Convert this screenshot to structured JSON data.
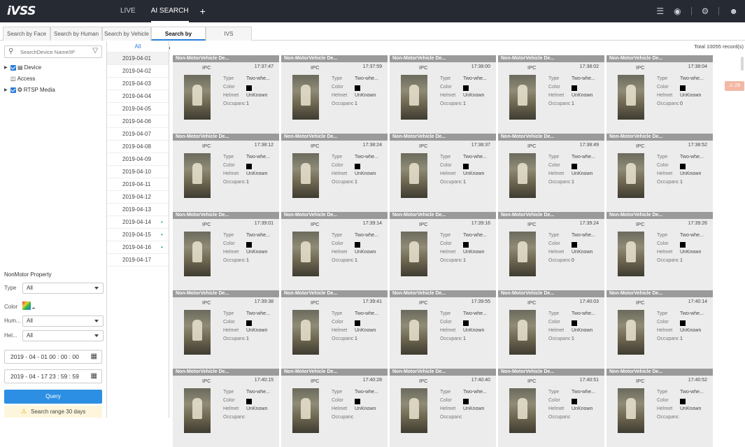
{
  "app": {
    "logo": "iVSS"
  },
  "topnav": {
    "items": [
      "LIVE",
      "AI SEARCH"
    ],
    "add": "+"
  },
  "tabs": [
    "Search by Face",
    "Search by Human",
    "Search by Vehicle",
    "Search by NonMotor",
    "IVS"
  ],
  "left": {
    "search_placeholder": "SearchDevice Name/IP",
    "tree": [
      "Device",
      "Access",
      "RTSP Media"
    ],
    "props_title": "NonMotor Property",
    "type_label": "Type",
    "type_value": "All",
    "color_label": "Color",
    "helmet_num_label": "Hum...",
    "helmet_num_value": "All",
    "helmet_label": "Hel...",
    "helmet_value": "All",
    "start_time": "2019 - 04 - 01   00 : 00 : 00",
    "end_time": "2019 - 04 - 17   23 : 59 : 59",
    "query": "Query",
    "warning": "Search range 30 days"
  },
  "dates": {
    "all": "All",
    "items": [
      "2019-04-01",
      "2019-04-02",
      "2019-04-03",
      "2019-04-04",
      "2019-04-05",
      "2019-04-06",
      "2019-04-07",
      "2019-04-08",
      "2019-04-09",
      "2019-04-10",
      "2019-04-11",
      "2019-04-12",
      "2019-04-13",
      "2019-04-14",
      "2019-04-15",
      "2019-04-16",
      "2019-04-17"
    ],
    "dotted": [
      "2019-04-14",
      "2019-04-15",
      "2019-04-16"
    ]
  },
  "results": {
    "total": "Total 10055 record(s)",
    "card_title": "Non-MotorVehicle De...",
    "source": "IPC",
    "labels": {
      "type": "Type",
      "color": "Color",
      "helmet": "Helmet",
      "occupants": "Occupanc"
    },
    "type_value": "Two-whe...",
    "helmet_value": "UnKnown",
    "cards": [
      {
        "time": "17:37:47",
        "occ": "1"
      },
      {
        "time": "17:37:59",
        "occ": "1"
      },
      {
        "time": "17:38:00",
        "occ": "1"
      },
      {
        "time": "17:38:02",
        "occ": "1"
      },
      {
        "time": "17:38:04",
        "occ": "0"
      },
      {
        "time": "17:38:12",
        "occ": "1"
      },
      {
        "time": "17:38:24",
        "occ": "1"
      },
      {
        "time": "17:38:37",
        "occ": "1"
      },
      {
        "time": "17:38:49",
        "occ": "1"
      },
      {
        "time": "17:38:52",
        "occ": "1"
      },
      {
        "time": "17:39:01",
        "occ": "1"
      },
      {
        "time": "17:39:14",
        "occ": "1"
      },
      {
        "time": "17:39:16",
        "occ": "1"
      },
      {
        "time": "17:39:24",
        "occ": "0"
      },
      {
        "time": "17:39:26",
        "occ": "1"
      },
      {
        "time": "17:39:38",
        "occ": "1"
      },
      {
        "time": "17:39:41",
        "occ": "1"
      },
      {
        "time": "17:39:55",
        "occ": "1"
      },
      {
        "time": "17:40:03",
        "occ": "1"
      },
      {
        "time": "17:40:14",
        "occ": "1"
      },
      {
        "time": "17:40:15",
        "occ": ""
      },
      {
        "time": "17:40:28",
        "occ": ""
      },
      {
        "time": "17:40:40",
        "occ": ""
      },
      {
        "time": "17:40:51",
        "occ": ""
      },
      {
        "time": "17:40:52",
        "occ": ""
      }
    ]
  },
  "alarm": {
    "text": "29",
    "icon": "warning-icon"
  }
}
